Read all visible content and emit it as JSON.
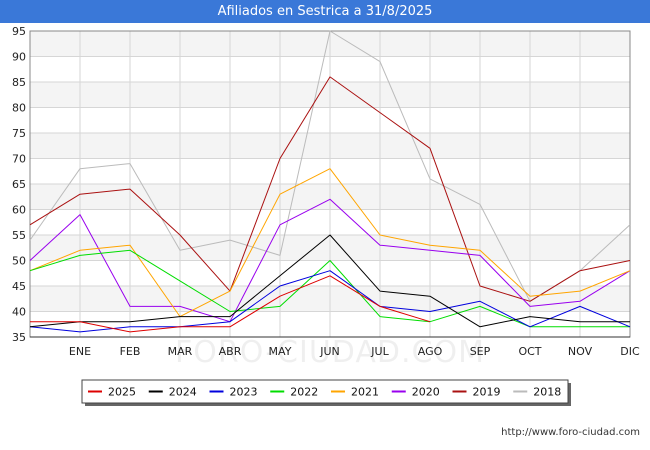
{
  "header": {
    "title": "Afiliados en Sestrica a 31/8/2025"
  },
  "footer": {
    "source": "http://www.foro-ciudad.com"
  },
  "watermark": "FORO-CIUDAD.COM",
  "chart_data": {
    "type": "line",
    "title": "Afiliados en Sestrica a 31/8/2025",
    "categories": [
      "",
      "ENE",
      "FEB",
      "MAR",
      "ABR",
      "MAY",
      "JUN",
      "JUL",
      "AGO",
      "SEP",
      "OCT",
      "NOV",
      "DIC"
    ],
    "ylim": [
      35,
      95
    ],
    "yticks": [
      35,
      40,
      45,
      50,
      55,
      60,
      65,
      70,
      75,
      80,
      85,
      90,
      95
    ],
    "grid": true,
    "legend": "bottom",
    "series": [
      {
        "name": "2025",
        "color": "#dd0000",
        "values": [
          38,
          38,
          36,
          37,
          37,
          43,
          47,
          41,
          38,
          null,
          null,
          null,
          null
        ]
      },
      {
        "name": "2024",
        "color": "#000000",
        "values": [
          37,
          38,
          38,
          39,
          39,
          47,
          55,
          44,
          43,
          37,
          39,
          38,
          38
        ]
      },
      {
        "name": "2023",
        "color": "#0000dd",
        "values": [
          37,
          36,
          37,
          37,
          38,
          45,
          48,
          41,
          40,
          42,
          37,
          41,
          37
        ]
      },
      {
        "name": "2022",
        "color": "#00dd00",
        "values": [
          48,
          51,
          52,
          46,
          40,
          41,
          50,
          39,
          38,
          41,
          37,
          37,
          37
        ]
      },
      {
        "name": "2021",
        "color": "#ffa500",
        "values": [
          48,
          52,
          53,
          39,
          44,
          63,
          68,
          55,
          53,
          52,
          43,
          44,
          48
        ]
      },
      {
        "name": "2020",
        "color": "#9900ee",
        "values": [
          50,
          59,
          41,
          41,
          38,
          57,
          62,
          53,
          52,
          51,
          41,
          42,
          48
        ]
      },
      {
        "name": "2019",
        "color": "#aa1111",
        "values": [
          57,
          63,
          64,
          55,
          44,
          70,
          86,
          79,
          72,
          45,
          42,
          48,
          50
        ]
      },
      {
        "name": "2018",
        "color": "#bbbbbb",
        "values": [
          54,
          68,
          69,
          52,
          54,
          51,
          95,
          89,
          66,
          61,
          42,
          48,
          57
        ]
      }
    ]
  }
}
